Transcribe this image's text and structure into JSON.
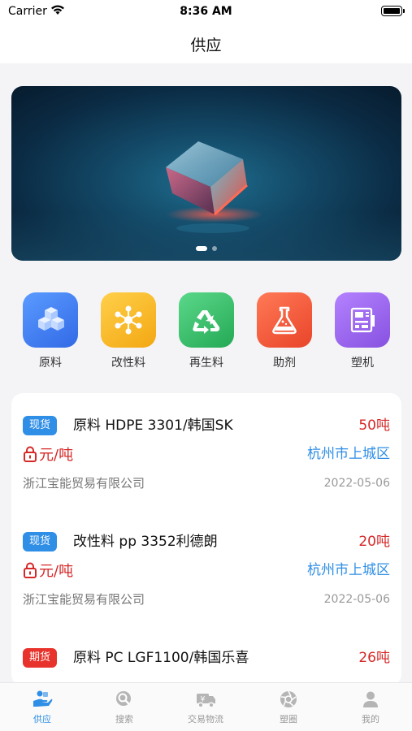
{
  "status_bar": {
    "carrier": "Carrier",
    "time": "8:36 AM"
  },
  "nav": {
    "title": "供应"
  },
  "banner": {
    "page_count": 2,
    "active_index": 0
  },
  "categories": [
    {
      "label": "原料",
      "icon": "cubes-icon",
      "color": "#3f7ff0"
    },
    {
      "label": "改性料",
      "icon": "molecule-icon",
      "color": "#f5b21e"
    },
    {
      "label": "再生料",
      "icon": "recycle-icon",
      "color": "#37c06a"
    },
    {
      "label": "助剂",
      "icon": "flask-icon",
      "color": "#f25a3a"
    },
    {
      "label": "塑机",
      "icon": "machine-icon",
      "color": "#9a63e6"
    }
  ],
  "listings": [
    {
      "tag": "现货",
      "tag_color": "#2f8ee5",
      "title": "原料 HDPE 3301/韩国SK",
      "quantity": "50吨",
      "price": "元/吨",
      "location": "杭州市上城区",
      "company": "浙江宝能贸易有限公司",
      "date": "2022-05-06"
    },
    {
      "tag": "现货",
      "tag_color": "#2f8ee5",
      "title": "改性料 pp 3352利德朗",
      "quantity": "20吨",
      "price": "元/吨",
      "location": "杭州市上城区",
      "company": "浙江宝能贸易有限公司",
      "date": "2022-05-06"
    },
    {
      "tag": "期货",
      "tag_color": "#e8322c",
      "title": "原料 PC LGF1100/韩国乐喜",
      "quantity": "26吨",
      "price": "",
      "location": "",
      "company": "",
      "date": ""
    }
  ],
  "tabs": [
    {
      "label": "供应",
      "icon": "supply-icon",
      "active": true
    },
    {
      "label": "搜索",
      "icon": "search-icon",
      "active": false
    },
    {
      "label": "交易物流",
      "icon": "truck-icon",
      "active": false
    },
    {
      "label": "塑圈",
      "icon": "aperture-icon",
      "active": false
    },
    {
      "label": "我的",
      "icon": "user-icon",
      "active": false
    }
  ],
  "colors": {
    "accent": "#2f8ee5",
    "price": "#d62828"
  }
}
